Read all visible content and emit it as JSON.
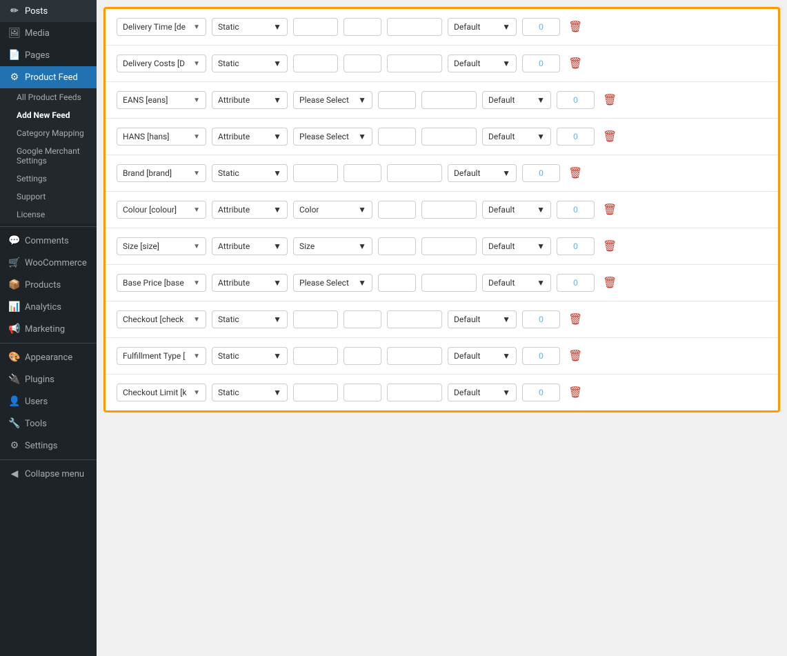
{
  "sidebar": {
    "items": [
      {
        "id": "posts",
        "label": "Posts",
        "icon": "📝",
        "active": false
      },
      {
        "id": "media",
        "label": "Media",
        "icon": "🖼",
        "active": false
      },
      {
        "id": "pages",
        "label": "Pages",
        "icon": "📄",
        "active": false
      },
      {
        "id": "product-feed",
        "label": "Product Feed",
        "icon": "⚙",
        "active": true
      },
      {
        "id": "comments",
        "label": "Comments",
        "icon": "💬",
        "active": false
      },
      {
        "id": "woocommerce",
        "label": "WooCommerce",
        "icon": "🛒",
        "active": false
      },
      {
        "id": "products",
        "label": "Products",
        "icon": "📦",
        "active": false
      },
      {
        "id": "analytics",
        "label": "Analytics",
        "icon": "📊",
        "active": false
      },
      {
        "id": "marketing",
        "label": "Marketing",
        "icon": "📢",
        "active": false
      },
      {
        "id": "appearance",
        "label": "Appearance",
        "icon": "🎨",
        "active": false
      },
      {
        "id": "plugins",
        "label": "Plugins",
        "icon": "🔌",
        "active": false
      },
      {
        "id": "users",
        "label": "Users",
        "icon": "👤",
        "active": false
      },
      {
        "id": "tools",
        "label": "Tools",
        "icon": "🔧",
        "active": false
      },
      {
        "id": "settings",
        "label": "Settings",
        "icon": "⚙",
        "active": false
      }
    ],
    "submenu": [
      {
        "id": "all-product-feeds",
        "label": "All Product Feeds",
        "bold": false
      },
      {
        "id": "add-new-feed",
        "label": "Add New Feed",
        "bold": true
      },
      {
        "id": "category-mapping",
        "label": "Category Mapping",
        "bold": false
      },
      {
        "id": "google-merchant",
        "label": "Google Merchant Settings",
        "bold": false
      },
      {
        "id": "settings-sub",
        "label": "Settings",
        "bold": false
      },
      {
        "id": "support",
        "label": "Support",
        "bold": false
      },
      {
        "id": "license",
        "label": "License",
        "bold": false
      }
    ],
    "collapse_label": "Collapse menu"
  },
  "rows": [
    {
      "id": "row-delivery-time",
      "field": "Delivery Time [de",
      "type": "Static",
      "value_select": null,
      "input1": "",
      "input2": "",
      "default": "Default",
      "number": "0"
    },
    {
      "id": "row-delivery-costs",
      "field": "Delivery Costs [D",
      "type": "Static",
      "value_select": null,
      "input1": "",
      "input2": "",
      "default": "Default",
      "number": "0"
    },
    {
      "id": "row-eans",
      "field": "EANS [eans]",
      "type": "Attribute",
      "value_select": "Please Select",
      "input1": "",
      "input2": "",
      "default": "Default",
      "number": "0"
    },
    {
      "id": "row-hans",
      "field": "HANS [hans]",
      "type": "Attribute",
      "value_select": "Please Select",
      "input1": "",
      "input2": "",
      "default": "Default",
      "number": "0"
    },
    {
      "id": "row-brand",
      "field": "Brand [brand]",
      "type": "Static",
      "value_select": null,
      "input1": "",
      "input2": "",
      "default": "Default",
      "number": "0"
    },
    {
      "id": "row-colour",
      "field": "Colour [colour]",
      "type": "Attribute",
      "value_select": "Color",
      "input1": "",
      "input2": "",
      "default": "Default",
      "number": "0"
    },
    {
      "id": "row-size",
      "field": "Size [size]",
      "type": "Attribute",
      "value_select": "Size",
      "input1": "",
      "input2": "",
      "default": "Default",
      "number": "0"
    },
    {
      "id": "row-base-price",
      "field": "Base Price [base",
      "type": "Attribute",
      "value_select": "Please Select",
      "input1": "",
      "input2": "",
      "default": "Default",
      "number": "0"
    },
    {
      "id": "row-checkout",
      "field": "Checkout [check",
      "type": "Static",
      "value_select": null,
      "input1": "",
      "input2": "",
      "default": "Default",
      "number": "0"
    },
    {
      "id": "row-fulfillment",
      "field": "Fulfillment Type [",
      "type": "Static",
      "value_select": null,
      "input1": "",
      "input2": "",
      "default": "Default",
      "number": "0"
    },
    {
      "id": "row-checkout-limit",
      "field": "Checkout Limit [k",
      "type": "Static",
      "value_select": null,
      "input1": "",
      "input2": "",
      "default": "Default",
      "number": "0"
    }
  ],
  "labels": {
    "chevron": "▼",
    "delete_icon": "🗑"
  }
}
